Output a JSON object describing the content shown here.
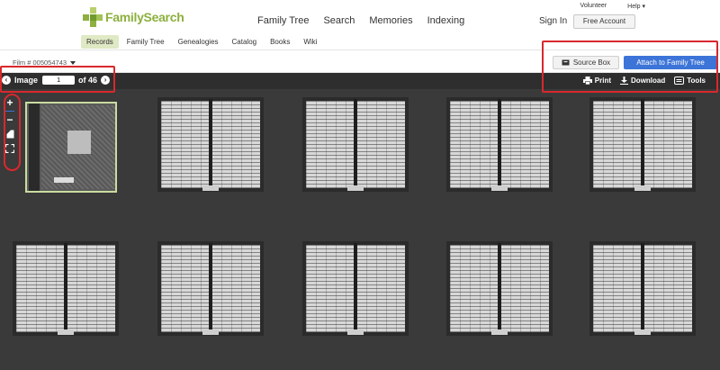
{
  "header": {
    "brand": "FamilySearch",
    "nav": [
      "Family Tree",
      "Search",
      "Memories",
      "Indexing"
    ],
    "top_links": [
      "Volunteer",
      "Help ▾"
    ],
    "sign_in": "Sign In",
    "free_account": "Free Account"
  },
  "subnav": {
    "items": [
      "Records",
      "Family Tree",
      "Genealogies",
      "Catalog",
      "Books",
      "Wiki"
    ],
    "active": "Records"
  },
  "film": {
    "label": "Film # 005054743"
  },
  "actions": {
    "source_box": "Source Box",
    "attach": "Attach to Family Tree"
  },
  "toolbar": {
    "image_label": "Image",
    "image_value": "1",
    "of_total": "of 46",
    "print": "Print",
    "download": "Download",
    "tools": "Tools"
  },
  "colors": {
    "brand_green": "#8db03e",
    "accent_blue": "#3c74d8",
    "highlight_red": "#d8282d",
    "viewer_bg": "#3a3a3a"
  }
}
